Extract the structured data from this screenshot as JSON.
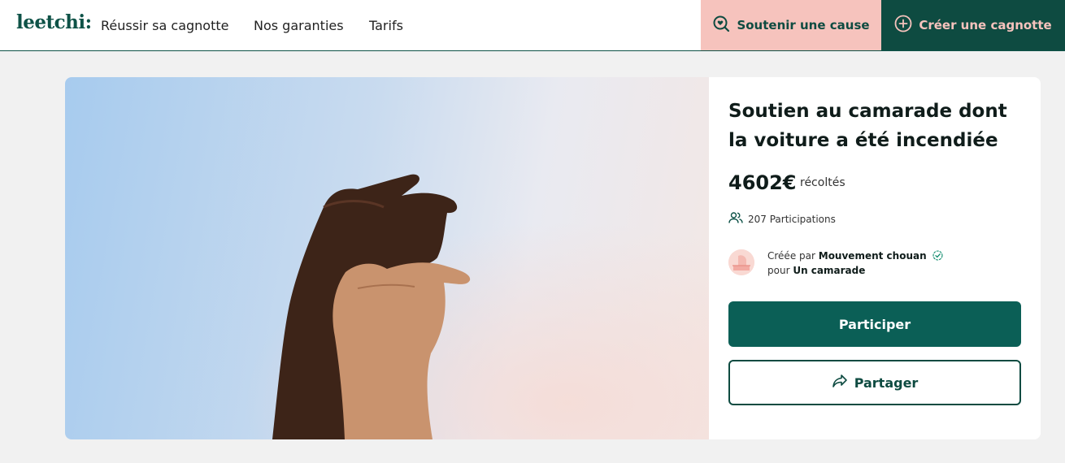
{
  "header": {
    "logo": "leetchi:",
    "nav": [
      "Réussir sa cagnotte",
      "Nos garanties",
      "Tarifs"
    ],
    "soutenir_label": "Soutenir une cause",
    "creer_label": "Créer une cagnotte"
  },
  "campaign": {
    "title": "Soutien au camarade dont la voiture a été incendiée",
    "amount": "4602€",
    "amount_label": "récoltés",
    "participations": "207 Participations",
    "created_by_prefix": "Créée par",
    "creator_name": "Mouvement chouan",
    "for_prefix": "pour",
    "beneficiary": "Un camarade",
    "participer_label": "Participer",
    "partager_label": "Partager"
  },
  "colors": {
    "brand_dark": "#0e4b41",
    "brand_primary": "#0b5f56",
    "accent_pink": "#f6c3bd"
  },
  "icons": {
    "soutenir": "search-heart-icon",
    "creer": "plus-circle-icon",
    "participations": "users-icon",
    "verified": "verified-check-icon",
    "partager": "share-arrow-icon"
  }
}
